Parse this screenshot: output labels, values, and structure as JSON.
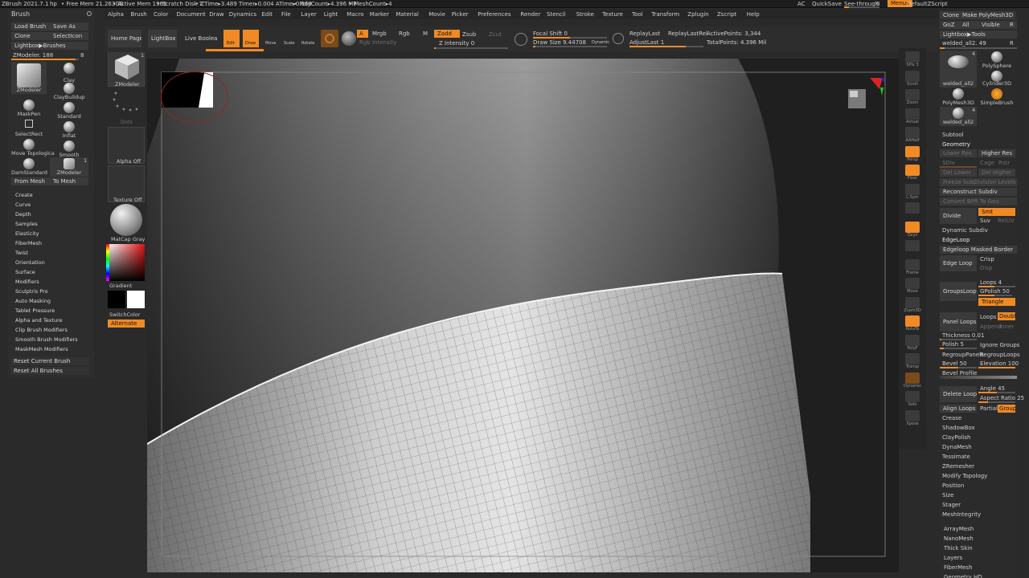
{
  "topbar": {
    "app": "ZBrush 2021.7.1",
    "user": "hp",
    "free_mem": "• Free Mem 21.263GB",
    "active_mem": "• Active Mem 1965",
    "scratch": "• Scratch Disk 7",
    "ztime": "• ZTime▸3.489 Timer▸0.004 ATime▸0.669",
    "polycount": "• PolyCount▸4.396 MP",
    "meshcount": "• MeshCount▸4",
    "ac": "AC",
    "quicksave": "QuickSave",
    "seethrough": "See-through",
    "seethrough_val": "0",
    "menus": "Menus",
    "default_script": "DefaultZScript"
  },
  "menubar": [
    "Alpha",
    "Brush",
    "Color",
    "Document",
    "Draw",
    "Dynamics",
    "Edit",
    "File",
    "Layer",
    "Light",
    "Macro",
    "Marker",
    "Material",
    "Movie",
    "Picker",
    "Preferences",
    "Render",
    "Stencil",
    "Stroke",
    "Texture",
    "Tool",
    "Transform",
    "Zplugin",
    "Zscript",
    "Help"
  ],
  "left": {
    "title": "Brush",
    "load": "Load Brush",
    "save": "Save As",
    "clone": "Clone",
    "select_icon": "SelectIcon",
    "lightbox": "Lightbox▶Brushes",
    "zmodeler_slider": "ZModeler. 188",
    "slider_num": "8",
    "brushes": [
      "ZModeler",
      "Clay",
      "ClayBuildup",
      "MaskPen",
      "Standard",
      "SelectRect",
      "Inflat",
      "Move Topologica",
      "Smooth",
      "DamStandard",
      "ZModeler"
    ],
    "zmod_badge": "1",
    "from_mesh": "From Mesh",
    "to_mesh": "To Mesh",
    "menu": [
      "Create",
      "Curve",
      "Depth",
      "Samples",
      "Elasticity",
      "FiberMesh",
      "Twist",
      "Orientation",
      "Surface",
      "Modifiers",
      "Sculptris Pro",
      "Auto Masking",
      "Tablet Pressure",
      "Alpha and Texture",
      "Clip Brush Modifiers",
      "Smooth Brush Modifiers",
      "MaskMesh Modifiers"
    ],
    "reset_current": "Reset Current Brush",
    "reset_all": "Reset All Brushes"
  },
  "strip": {
    "zmodeler": "ZModeler",
    "dots": "Dots",
    "alpha_off": "Alpha Off",
    "texture_off": "Texture Off",
    "matcap": "MatCap Gray",
    "gradient": "Gradient",
    "switch": "SwitchColor",
    "alternate": "Alternate",
    "badge": "1"
  },
  "toolbar": {
    "home": "Home Page",
    "lightbox": "LightBox",
    "live_boolean": "Live Boolean",
    "edit": "Edit",
    "draw": "Draw",
    "move": "Move",
    "scale": "Scale",
    "rotate": "Rotate",
    "a": "A",
    "mrgb": "Mrgb",
    "rgb": "Rgb",
    "m": "M",
    "zadd": "Zadd",
    "zsub": "Zsub",
    "zcut": "Zcut",
    "rgb_intensity": "Rgb Intensity",
    "z_intensity": "Z Intensity 0",
    "focal": "Focal Shift 0",
    "draw_size": "Draw Size 9.44708",
    "dynamic": "Dynamic",
    "replay": "ReplayLast",
    "replay_rel": "ReplayLastRel",
    "adjust": "AdjustLast 1",
    "active_points": "ActivePoints: 3,344",
    "total_points": "TotalPoints: 4.396 Mil"
  },
  "rightstrip": [
    "SPix 3",
    "Scroll",
    "Zoom",
    "Actual",
    "AAHalf",
    "Persp",
    "Floor",
    "L.Sym",
    "",
    "Qxyz",
    "",
    "Frame",
    "Move",
    "Zoom3D",
    "RotaTe",
    "PolyF",
    "Transp",
    "Dynamic",
    "Solo",
    "Xpose"
  ],
  "right": {
    "clone": "Clone",
    "make_poly": "Make PolyMesh3D",
    "goz": "GoZ",
    "all": "All",
    "visible": "Visible",
    "r": "R",
    "lightbox_tools": "Lightbox▶Tools",
    "welded": "welded_all2. 49",
    "r2": "R",
    "tools": [
      "welded_all2",
      "PolySphere",
      "Cylinder3D",
      "PolyMesh3D",
      "SimpleBrush",
      "welded_all2"
    ],
    "tool_badge": "4",
    "subtool": "Subtool",
    "geometry": "Geometry",
    "lower_res": "Lower Res",
    "higher_res": "Higher Res",
    "sdiv": "SDiv",
    "cage": "Cage",
    "rstr": "Rstr",
    "del_lower": "Del Lower",
    "del_higher": "Del Higher",
    "freeze": "Freeze SubDivision Levels",
    "reconstruct": "Reconstruct Subdiv",
    "convert_bpr": "Convert BPR To Geo",
    "divide": "Divide",
    "smt": "Smt",
    "suv": "Suv",
    "reluv": "RelUV",
    "dynamic_subdiv": "Dynamic Subdiv",
    "edgeloop": "EdgeLoop",
    "edgeloop_masked": "Edgeloop Masked Border",
    "edge_loop": "Edge Loop",
    "crisp": "Crisp",
    "disp": "Disp",
    "groups_loops": "GroupsLoops",
    "loops4": "Loops 4",
    "gpolish": "GPolish 50",
    "triangle": "Triangle",
    "panel_loops": "Panel Loops",
    "loops": "Loops",
    "double": "Double",
    "append": "Append",
    "inner": "Inner",
    "thickness": "Thickness 0.01",
    "polish": "Polish 5",
    "ignore_groups": "Ignore Groups",
    "regroup_panels": "RegroupPanels",
    "regroup_loops": "RegroupLoops",
    "bevel": "Bevel 50",
    "elevation": "Elevation 100",
    "bevel_profile": "Bevel Profile",
    "delete_loops": "Delete Loops",
    "angle": "Angle 45",
    "aspect": "Aspect Ratio 25",
    "align_loops": "Align Loops",
    "partial": "Partial",
    "groups": "Groups",
    "list": [
      "Crease",
      "ShadowBox",
      "ClayPolish",
      "DynaMesh",
      "Tessimate",
      "ZRemesher",
      "Modify Topology",
      "Position",
      "Size",
      "Stager",
      "MeshIntegrity"
    ],
    "list2": [
      "ArrayMesh",
      "NanoMesh",
      "Thick Skin",
      "Layers",
      "FiberMesh",
      "Geometry HD"
    ]
  },
  "colors": {
    "accent": "#f08a24",
    "panel": "#2b2b2b",
    "canvas": "#1f1f1f"
  }
}
